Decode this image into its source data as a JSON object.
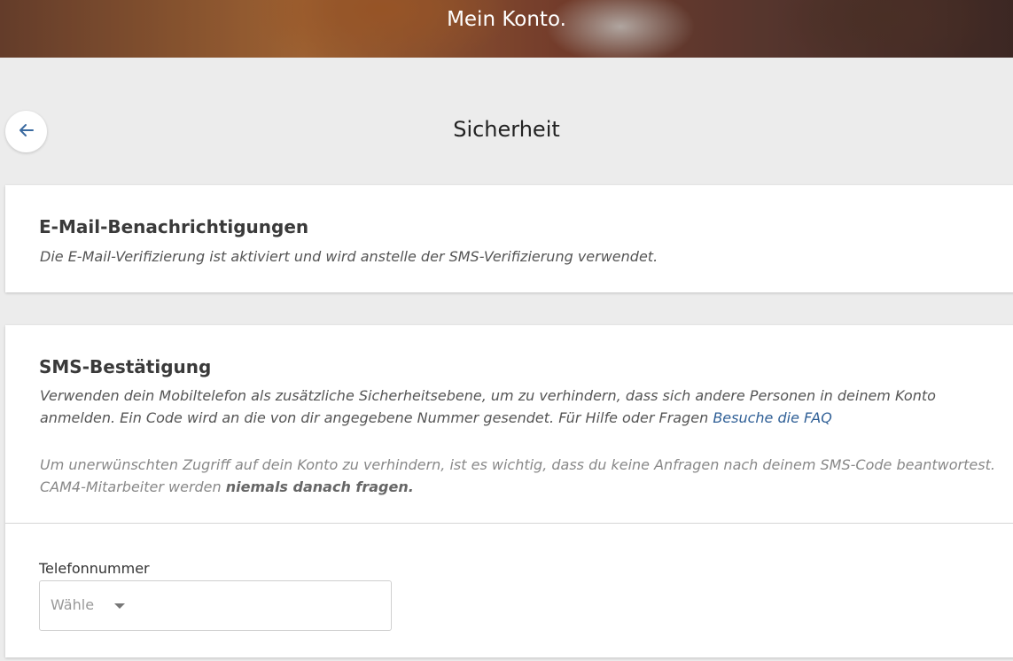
{
  "header": {
    "title": "Mein Konto."
  },
  "page": {
    "title": "Sicherheit",
    "back_icon": "arrow-left-icon"
  },
  "email_section": {
    "heading": "E-Mail-Benachrichtigungen",
    "description": "Die E-Mail-Verifizierung ist aktiviert und wird anstelle der SMS-Verifizierung verwendet."
  },
  "sms_section": {
    "heading": "SMS-Bestätigung",
    "description": "Verwenden dein Mobiltelefon als zusätzliche Sicherheitsebene, um zu verhindern, dass sich andere Personen in deinem Konto anmelden. Ein Code wird an die von dir angegebene Nummer gesendet. Für Hilfe oder Fragen",
    "faq_link": "Besuche die FAQ",
    "warning_text": "Um unerwünschten Zugriff auf dein Konto zu verhindern, ist es wichtig, dass du keine Anfragen nach deinem SMS-Code beantwortest. CAM4-Mitarbeiter werden",
    "warning_emphasis": "niemals danach fragen.",
    "phone_label": "Telefonnummer",
    "phone_select_value": "Wähle"
  },
  "colors": {
    "link": "#2f5f96",
    "back_arrow": "#3a6aa0"
  }
}
